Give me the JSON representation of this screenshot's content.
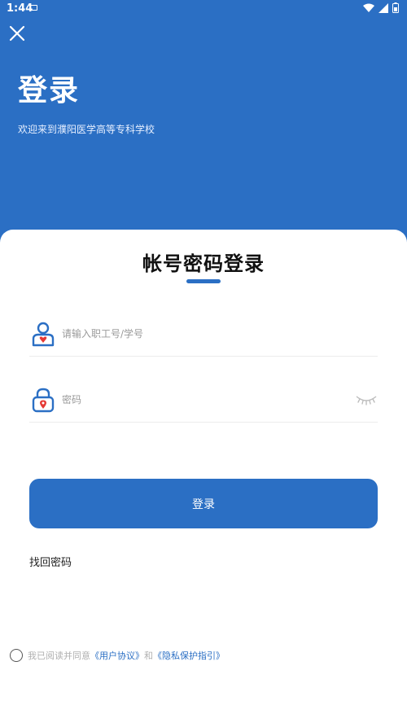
{
  "status": {
    "time": "1:44"
  },
  "header": {
    "title": "登录",
    "welcome": "欢迎来到濮阳医学高等专科学校"
  },
  "card": {
    "title": "帐号密码登录",
    "username_placeholder": "请输入职工号/学号",
    "password_placeholder": "密码",
    "login_label": "登录",
    "forgot_label": "找回密码"
  },
  "agreement": {
    "prefix": "我已阅读并同意",
    "user_agreement": "《用户协议》",
    "and": "和",
    "privacy_policy": "《隐私保护指引》"
  },
  "icons": {
    "close": "close-icon",
    "user": "user-icon",
    "lock": "lock-icon",
    "eye": "eye-closed-icon"
  },
  "colors": {
    "primary": "#2b6fc4",
    "accent_red": "#e53935"
  }
}
